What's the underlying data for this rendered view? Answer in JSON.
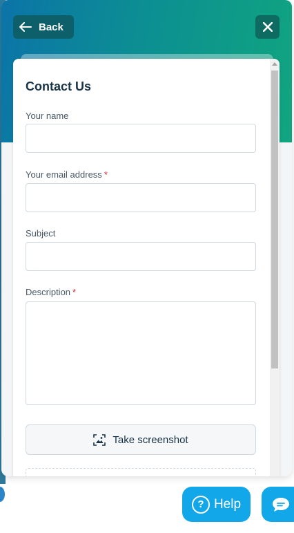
{
  "header": {
    "back_label": "Back",
    "close_icon": "close-icon"
  },
  "form": {
    "title": "Contact Us",
    "fields": [
      {
        "label": "Your name",
        "required": false,
        "value": ""
      },
      {
        "label": "Your email address",
        "required": true,
        "value": ""
      },
      {
        "label": "Subject",
        "required": false,
        "value": ""
      },
      {
        "label": "Description",
        "required": true,
        "value": ""
      }
    ],
    "required_marker": "*",
    "screenshot_label": "Take screenshot"
  },
  "launcher": {
    "help_label": "Help",
    "help_icon": "question-icon",
    "chat_icon": "chat-bubble-icon"
  },
  "colors": {
    "accent": "#12a7e8",
    "header_start": "#0b74a8",
    "header_end": "#10a57f",
    "required": "#d72d30"
  }
}
